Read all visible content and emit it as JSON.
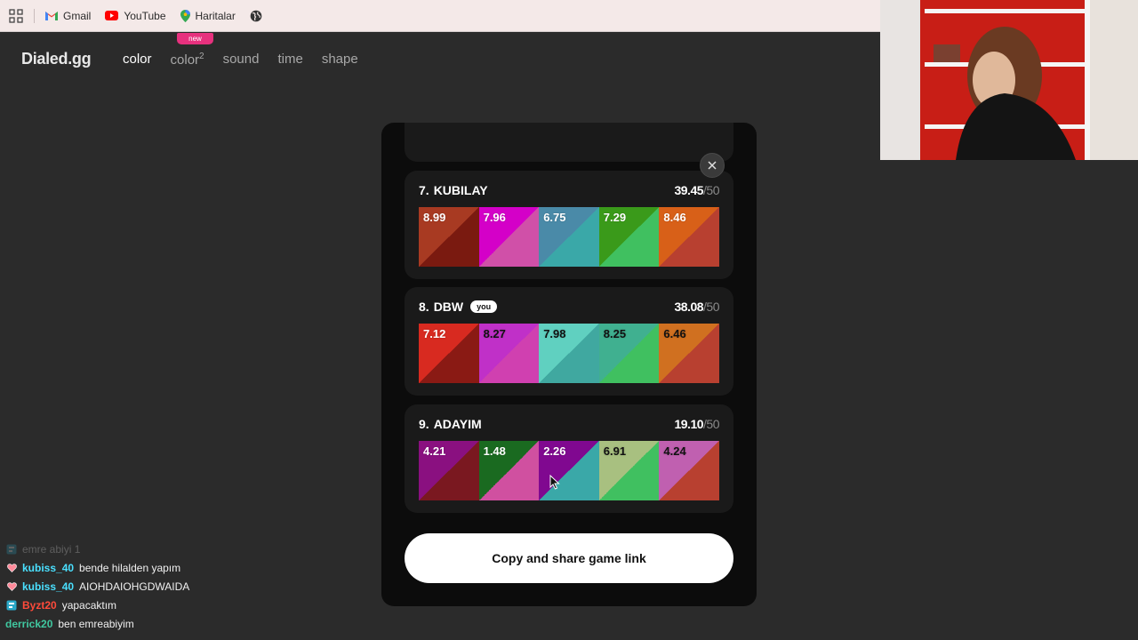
{
  "bookmarks": [
    {
      "label": "Gmail",
      "icon": "gmail-icon"
    },
    {
      "label": "YouTube",
      "icon": "youtube-icon"
    },
    {
      "label": "Haritalar",
      "icon": "maps-pin-icon"
    }
  ],
  "site": {
    "logo": "Dialed.gg",
    "nav": [
      {
        "label": "color",
        "active": true
      },
      {
        "label": "color",
        "sup": "2",
        "badge": "new"
      },
      {
        "label": "sound"
      },
      {
        "label": "time"
      },
      {
        "label": "shape"
      }
    ]
  },
  "leaderboard": {
    "cards": [
      {
        "rank": "7.",
        "name": "KUBILAY",
        "score": "39.45",
        "max": "/50",
        "swatches": [
          {
            "value": "8.99",
            "top": "#a83a22",
            "bottom": "#7a1a10"
          },
          {
            "value": "7.96",
            "top": "#d400c8",
            "bottom": "#d050a8"
          },
          {
            "value": "6.75",
            "top": "#4a8aa8",
            "bottom": "#3aa8a8"
          },
          {
            "value": "7.29",
            "top": "#3a9a1a",
            "bottom": "#40c060"
          },
          {
            "value": "8.46",
            "top": "#d86018",
            "bottom": "#b84030"
          }
        ]
      },
      {
        "rank": "8.",
        "name": "DBW",
        "you": "you",
        "score": "38.08",
        "max": "/50",
        "swatches": [
          {
            "value": "7.12",
            "top": "#d82a20",
            "bottom": "#8a1a14"
          },
          {
            "value": "8.27",
            "top": "#c030c8",
            "bottom": "#d040b0",
            "dark": true
          },
          {
            "value": "7.98",
            "top": "#60d0c0",
            "bottom": "#40a8a0",
            "dark": true
          },
          {
            "value": "8.25",
            "top": "#40b090",
            "bottom": "#40c060",
            "dark": true
          },
          {
            "value": "6.46",
            "top": "#d07020",
            "bottom": "#b84030",
            "dark": true
          }
        ]
      },
      {
        "rank": "9.",
        "name": "ADAYIM",
        "score": "19.10",
        "max": "/50",
        "swatches": [
          {
            "value": "4.21",
            "top": "#8a1080",
            "bottom": "#7a1820"
          },
          {
            "value": "1.48",
            "top": "#1a6a20",
            "bottom": "#d050a0"
          },
          {
            "value": "2.26",
            "top": "#800890",
            "bottom": "#3aa8a8"
          },
          {
            "value": "6.91",
            "top": "#a8c080",
            "bottom": "#40c060",
            "dark": true
          },
          {
            "value": "4.24",
            "top": "#c060b0",
            "bottom": "#b84030",
            "dark": true
          }
        ]
      }
    ]
  },
  "share_button": "Copy and share game link",
  "chat": [
    {
      "user": "",
      "message": "emre abiyi 1",
      "icon": "chat-badge-icon",
      "faded": true,
      "color": "#40c0a0"
    },
    {
      "user": "kubiss_40",
      "message": "bende hilalden yapım",
      "icon": "heart-icon",
      "color": "#4ae0ff"
    },
    {
      "user": "kubiss_40",
      "message": "AIOHDAIOHGDWAIDA",
      "icon": "heart-icon",
      "color": "#4ae0ff"
    },
    {
      "user": "Byzt20",
      "message": "yapacaktım",
      "icon": "chat-badge-icon",
      "color": "#ff4a3a"
    },
    {
      "user": "derrick20",
      "message": "ben emreabiyim",
      "icon": "",
      "color": "#40c8a0"
    }
  ]
}
